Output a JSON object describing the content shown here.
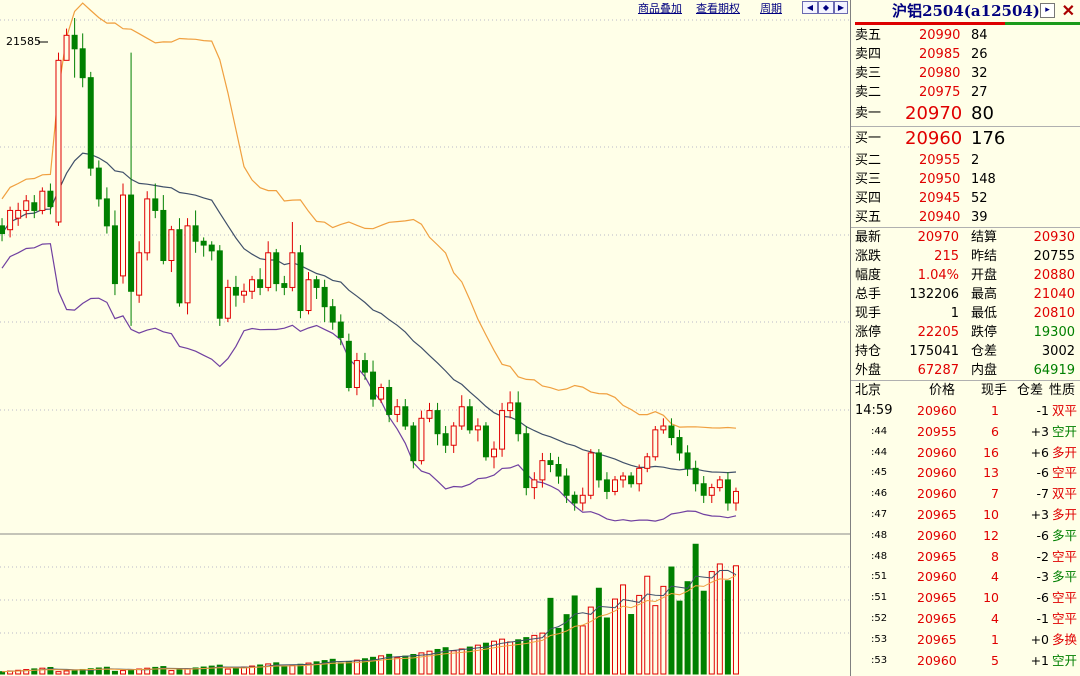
{
  "toolbar": {
    "links": [
      "商品叠加",
      "查看期权",
      "周期"
    ],
    "nav_icons": [
      "arrow-left-icon",
      "arrow-both-icon",
      "arrow-right-icon",
      "zoom-icon"
    ]
  },
  "chart_data": {
    "type": "candlestick",
    "high_label": "21585",
    "candles": [
      [
        20560,
        20520,
        20600,
        20480
      ],
      [
        20540,
        20640,
        20660,
        20500
      ],
      [
        20600,
        20640,
        20680,
        20560
      ],
      [
        20640,
        20690,
        20720,
        20600
      ],
      [
        20680,
        20640,
        20720,
        20600
      ],
      [
        20640,
        20740,
        20760,
        20620
      ],
      [
        20740,
        20660,
        20780,
        20620
      ],
      [
        20580,
        21420,
        21460,
        20560
      ],
      [
        21420,
        21550,
        21585,
        21420
      ],
      [
        21550,
        21480,
        21640,
        21330
      ],
      [
        21480,
        21330,
        21560,
        21280
      ],
      [
        21330,
        20860,
        21360,
        20820
      ],
      [
        20860,
        20700,
        20900,
        20660
      ],
      [
        20700,
        20560,
        20760,
        20520
      ],
      [
        20560,
        20260,
        20640,
        20200
      ],
      [
        20300,
        20720,
        20780,
        20260
      ],
      [
        20720,
        20220,
        21460,
        20040
      ],
      [
        20200,
        20420,
        20480,
        20160
      ],
      [
        20420,
        20700,
        20740,
        20380
      ],
      [
        20700,
        20640,
        20780,
        20600
      ],
      [
        20640,
        20380,
        20720,
        20360
      ],
      [
        20380,
        20540,
        20560,
        20320
      ],
      [
        20540,
        20160,
        20600,
        20140
      ],
      [
        20160,
        20560,
        20600,
        20100
      ],
      [
        20560,
        20480,
        20640,
        20420
      ],
      [
        20480,
        20460,
        20500,
        20400
      ],
      [
        20460,
        20430,
        20480,
        20380
      ],
      [
        20430,
        20080,
        20460,
        20040
      ],
      [
        20080,
        20240,
        20280,
        20060
      ],
      [
        20240,
        20200,
        20300,
        20140
      ],
      [
        20200,
        20220,
        20260,
        20160
      ],
      [
        20220,
        20280,
        20300,
        20180
      ],
      [
        20280,
        20240,
        20340,
        20200
      ],
      [
        20240,
        20420,
        20480,
        20220
      ],
      [
        20420,
        20260,
        20440,
        20220
      ],
      [
        20260,
        20240,
        20300,
        20200
      ],
      [
        20240,
        20420,
        20580,
        20220
      ],
      [
        20420,
        20120,
        20460,
        20080
      ],
      [
        20120,
        20280,
        20320,
        20100
      ],
      [
        20280,
        20240,
        20300,
        20180
      ],
      [
        20240,
        20140,
        20280,
        20060
      ],
      [
        20140,
        20060,
        20180,
        20020
      ],
      [
        20060,
        19980,
        20100,
        19940
      ],
      [
        19960,
        19720,
        20000,
        19700
      ],
      [
        19720,
        19860,
        19900,
        19680
      ],
      [
        19860,
        19800,
        19900,
        19760
      ],
      [
        19800,
        19660,
        19860,
        19620
      ],
      [
        19660,
        19720,
        19740,
        19640
      ],
      [
        19720,
        19580,
        19760,
        19540
      ],
      [
        19580,
        19620,
        19660,
        19540
      ],
      [
        19620,
        19520,
        19660,
        19500
      ],
      [
        19520,
        19340,
        19540,
        19300
      ],
      [
        19340,
        19560,
        19600,
        19320
      ],
      [
        19560,
        19600,
        19640,
        19540
      ],
      [
        19600,
        19480,
        19640,
        19420
      ],
      [
        19480,
        19420,
        19520,
        19380
      ],
      [
        19420,
        19520,
        19540,
        19380
      ],
      [
        19520,
        19620,
        19680,
        19500
      ],
      [
        19620,
        19500,
        19660,
        19480
      ],
      [
        19500,
        19520,
        19560,
        19440
      ],
      [
        19520,
        19360,
        19540,
        19340
      ],
      [
        19360,
        19400,
        19440,
        19300
      ],
      [
        19400,
        19600,
        19640,
        19360
      ],
      [
        19600,
        19640,
        19700,
        19560
      ],
      [
        19640,
        19480,
        19700,
        19440
      ],
      [
        19480,
        19200,
        19520,
        19160
      ],
      [
        19200,
        19240,
        19280,
        19140
      ],
      [
        19240,
        19340,
        19380,
        19200
      ],
      [
        19340,
        19320,
        19380,
        19280
      ],
      [
        19320,
        19260,
        19360,
        19220
      ],
      [
        19260,
        19160,
        19300,
        19120
      ],
      [
        19160,
        19120,
        19180,
        19080
      ],
      [
        19120,
        19160,
        19200,
        19080
      ],
      [
        19160,
        19380,
        19400,
        19140
      ],
      [
        19380,
        19240,
        19400,
        19200
      ],
      [
        19240,
        19180,
        19280,
        19140
      ],
      [
        19180,
        19240,
        19260,
        19160
      ],
      [
        19240,
        19260,
        19280,
        19200
      ],
      [
        19260,
        19220,
        19280,
        19200
      ],
      [
        19220,
        19300,
        19320,
        19180
      ],
      [
        19300,
        19360,
        19380,
        19280
      ],
      [
        19360,
        19500,
        19520,
        19340
      ],
      [
        19500,
        19520,
        19560,
        19480
      ],
      [
        19520,
        19460,
        19560,
        19420
      ],
      [
        19460,
        19380,
        19500,
        19340
      ],
      [
        19380,
        19300,
        19420,
        19260
      ],
      [
        19300,
        19220,
        19340,
        19180
      ],
      [
        19220,
        19160,
        19260,
        19120
      ],
      [
        19160,
        19200,
        19220,
        19120
      ],
      [
        19200,
        19240,
        19260,
        19180
      ],
      [
        19240,
        19120,
        19280,
        19080
      ],
      [
        19120,
        19180,
        19200,
        19080
      ]
    ],
    "volume_bars": "approximate"
  },
  "sidebar": {
    "title": "沪铝2504(a12504)",
    "title_icon": "toggle-icon",
    "close_icon": "close-icon",
    "asks": [
      {
        "label": "卖五",
        "price": "20990",
        "vol": "84"
      },
      {
        "label": "卖四",
        "price": "20985",
        "vol": "26"
      },
      {
        "label": "卖三",
        "price": "20980",
        "vol": "32"
      },
      {
        "label": "卖二",
        "price": "20975",
        "vol": "27"
      },
      {
        "label": "卖一",
        "price": "20970",
        "vol": "80"
      }
    ],
    "bids": [
      {
        "label": "买一",
        "price": "20960",
        "vol": "176"
      },
      {
        "label": "买二",
        "price": "20955",
        "vol": "2"
      },
      {
        "label": "买三",
        "price": "20950",
        "vol": "148"
      },
      {
        "label": "买四",
        "price": "20945",
        "vol": "52"
      },
      {
        "label": "买五",
        "price": "20940",
        "vol": "39"
      }
    ],
    "stats": [
      {
        "l1": "最新",
        "v1": "20970",
        "c1": "red",
        "l2": "结算",
        "v2": "20930",
        "c2": "red"
      },
      {
        "l1": "涨跌",
        "v1": "215",
        "c1": "red",
        "l2": "昨结",
        "v2": "20755",
        "c2": "gray"
      },
      {
        "l1": "幅度",
        "v1": "1.04%",
        "c1": "red",
        "l2": "开盘",
        "v2": "20880",
        "c2": "red"
      },
      {
        "l1": "总手",
        "v1": "132206",
        "c1": "gray",
        "l2": "最高",
        "v2": "21040",
        "c2": "red"
      },
      {
        "l1": "现手",
        "v1": "1",
        "c1": "gray",
        "l2": "最低",
        "v2": "20810",
        "c2": "red"
      },
      {
        "l1": "涨停",
        "v1": "22205",
        "c1": "red",
        "l2": "跌停",
        "v2": "19300",
        "c2": "green"
      },
      {
        "l1": "持仓",
        "v1": "175041",
        "c1": "gray",
        "l2": "仓差",
        "v2": "3002",
        "c2": "gray"
      },
      {
        "l1": "外盘",
        "v1": "67287",
        "c1": "red",
        "l2": "内盘",
        "v2": "64919",
        "c2": "green"
      }
    ],
    "tick_header": {
      "loc": "北京",
      "price": "价格",
      "vol": "现手",
      "oi": "仓差",
      "nature": "性质"
    },
    "ticks": [
      {
        "t": "14:59",
        "p": "20960",
        "v": "1",
        "oi": "-1",
        "n": "双平",
        "nc": "red"
      },
      {
        "t": ":44",
        "p": "20955",
        "v": "6",
        "oi": "+3",
        "n": "空开",
        "nc": "green"
      },
      {
        "t": ":44",
        "p": "20960",
        "v": "16",
        "oi": "+6",
        "n": "多开",
        "nc": "red"
      },
      {
        "t": ":45",
        "p": "20960",
        "v": "13",
        "oi": "-6",
        "n": "空平",
        "nc": "red"
      },
      {
        "t": ":46",
        "p": "20960",
        "v": "7",
        "oi": "-7",
        "n": "双平",
        "nc": "red"
      },
      {
        "t": ":47",
        "p": "20965",
        "v": "10",
        "oi": "+3",
        "n": "多开",
        "nc": "red"
      },
      {
        "t": ":48",
        "p": "20960",
        "v": "12",
        "oi": "-6",
        "n": "多平",
        "nc": "green"
      },
      {
        "t": ":48",
        "p": "20965",
        "v": "8",
        "oi": "-2",
        "n": "空平",
        "nc": "red"
      },
      {
        "t": ":51",
        "p": "20960",
        "v": "4",
        "oi": "-3",
        "n": "多平",
        "nc": "green"
      },
      {
        "t": ":51",
        "p": "20965",
        "v": "10",
        "oi": "-6",
        "n": "空平",
        "nc": "red"
      },
      {
        "t": ":52",
        "p": "20965",
        "v": "4",
        "oi": "-1",
        "n": "空平",
        "nc": "red"
      },
      {
        "t": ":53",
        "p": "20965",
        "v": "1",
        "oi": "+0",
        "n": "多换",
        "nc": "red"
      },
      {
        "t": ":53",
        "p": "20960",
        "v": "5",
        "oi": "+1",
        "n": "空开",
        "nc": "green"
      }
    ]
  }
}
